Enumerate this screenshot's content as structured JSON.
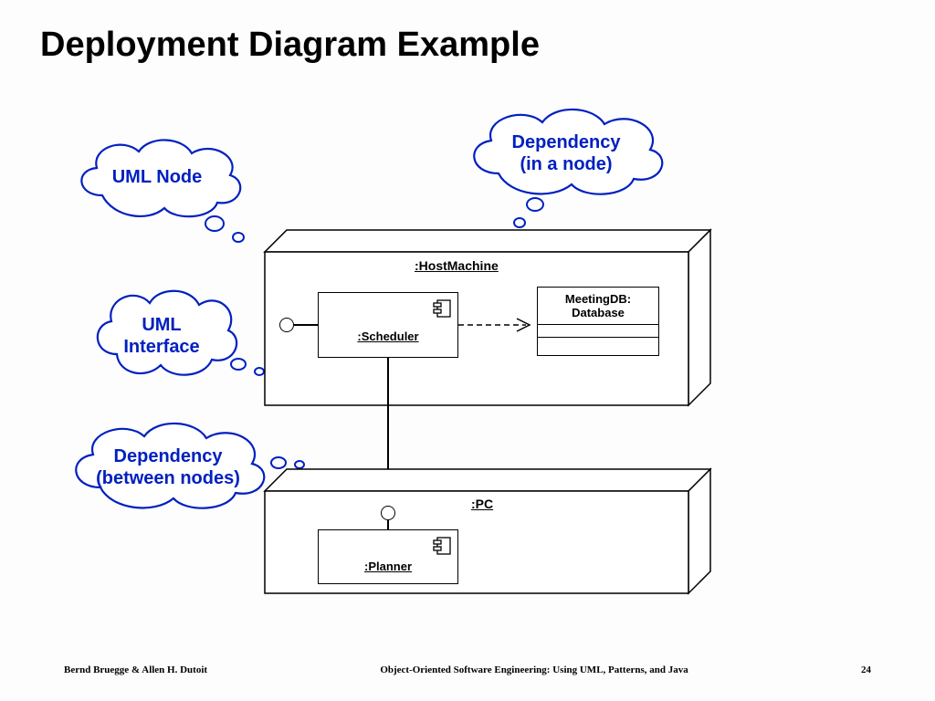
{
  "title": "Deployment Diagram Example",
  "annotations": {
    "uml_node": "UML Node",
    "dep_in_node_l1": "Dependency",
    "dep_in_node_l2": "(in a node)",
    "uml_interface_l1": "UML",
    "uml_interface_l2": "Interface",
    "dep_between_l1": "Dependency",
    "dep_between_l2": "(between nodes)"
  },
  "nodes": {
    "host": ":HostMachine",
    "pc": ":PC"
  },
  "components": {
    "scheduler": ":Scheduler",
    "planner": ":Planner",
    "meetingdb_l1": "MeetingDB:",
    "meetingdb_l2": "Database"
  },
  "footer": {
    "authors": "Bernd Bruegge & Allen H. Dutoit",
    "book": "Object-Oriented Software Engineering: Using UML, Patterns, and Java",
    "page": "24"
  }
}
